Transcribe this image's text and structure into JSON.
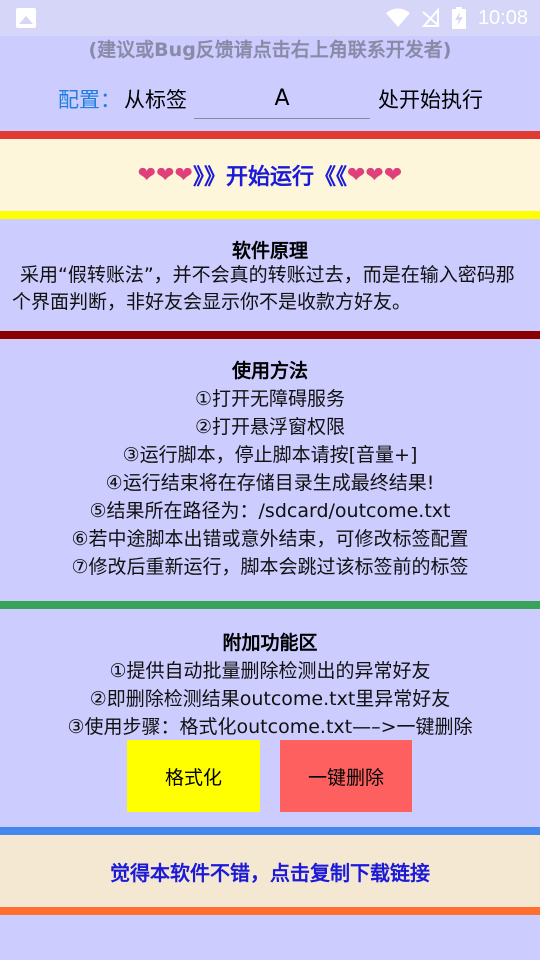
{
  "status_bar": {
    "time": "10:08"
  },
  "hint": "(建议或Bug反馈请点击右上角联系开发者)",
  "config": {
    "label": "配置：",
    "from_text": "从标签",
    "tag_value": "A",
    "after_text": "处开始执行"
  },
  "run_banner": {
    "left_hearts": "❤❤❤",
    "text": "》》开始运行《《",
    "right_hearts": "❤❤❤"
  },
  "principle": {
    "title": "软件原理",
    "text": "采用“假转账法”，并不会真的转账过去，而是在输入密码那个界面判断，非好友会显示你不是收款方好友。"
  },
  "usage": {
    "title": "使用方法",
    "steps": [
      "①打开无障碍服务",
      "②打开悬浮窗权限",
      "③运行脚本，停止脚本请按[音量+]",
      "④运行结束将在存储目录生成最终结果!",
      "⑤结果所在路径为：/sdcard/outcome.txt",
      "⑥若中途脚本出错或意外结束，可修改标签配置",
      "⑦修改后重新运行，脚本会跳过该标签前的标签"
    ]
  },
  "extra": {
    "title": "附加功能区",
    "lines": [
      "①提供自动批量删除检测出的异常好友",
      "②即删除检测结果outcome.txt里异常好友",
      "③使用步骤：格式化outcome.txt—–>一键删除"
    ],
    "format_button": "格式化",
    "delete_button": "一键删除"
  },
  "footer_link": "觉得本软件不错，点击复制下载链接",
  "colors": {
    "background": "#ccccfe",
    "accent_blue": "#1a1ad8",
    "config_blue": "#1f7fe0",
    "heart_pink": "#e0407a",
    "bar_red": "#e03a33",
    "bar_yellow": "#fefe00",
    "bar_darkred": "#880000",
    "bar_green": "#3aa35a",
    "bar_blue": "#4488ee",
    "bar_orange": "#ff7030",
    "button_yellow": "#ffff00",
    "button_red": "#fe6060"
  }
}
